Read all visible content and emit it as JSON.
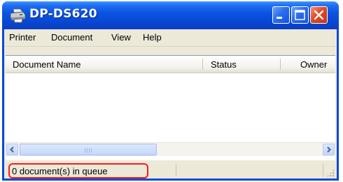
{
  "window": {
    "title": "DP-DS620",
    "icon": "printer-icon",
    "controls": {
      "minimize": "minimize-icon",
      "maximize": "maximize-icon",
      "close": "close-icon"
    }
  },
  "menu": {
    "items": [
      {
        "label": "Printer"
      },
      {
        "label": "Document"
      },
      {
        "label": "View"
      },
      {
        "label": "Help"
      }
    ]
  },
  "list": {
    "columns": [
      {
        "label": "Document Name"
      },
      {
        "label": "Status"
      },
      {
        "label": "Owner"
      }
    ],
    "rows": []
  },
  "scrollbar": {
    "left_icon": "chevron-left-icon",
    "right_icon": "chevron-right-icon"
  },
  "status": {
    "queue_text": "0 document(s) in queue",
    "highlight_color": "#ff1a1a"
  },
  "colors": {
    "titlebar": "#0846d2",
    "close_button": "#e04a24",
    "client_bg": "#ece9d8"
  }
}
